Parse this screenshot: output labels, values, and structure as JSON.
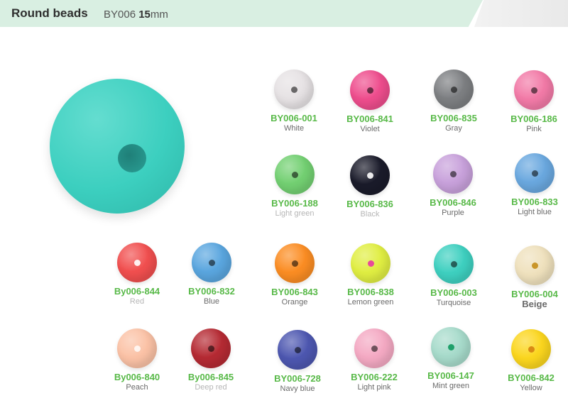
{
  "header": {
    "title": "Round beads",
    "code_prefix": "BY006",
    "size_value": "15",
    "size_unit": "mm"
  },
  "colors": {
    "header_band": "#d9efe2",
    "hero_bead": "#3ccfbf",
    "code_text": "#58b948"
  },
  "beads": [
    {
      "code": "BY006-001",
      "name": "White",
      "color": "#e6e2e4"
    },
    {
      "code": "BY006-841",
      "name": "Violet",
      "color": "#ee4d8d"
    },
    {
      "code": "BY006-835",
      "name": "Gray",
      "color": "#7d7f82"
    },
    {
      "code": "BY006-186",
      "name": "Pink",
      "color": "#f27aa7"
    },
    {
      "code": "BY006-188",
      "name": "Light green",
      "color": "#73d072"
    },
    {
      "code": "BY006-836",
      "name": "Black",
      "color": "#1a1b2a"
    },
    {
      "code": "BY006-846",
      "name": "Purple",
      "color": "#c8a1db"
    },
    {
      "code": "BY006-833",
      "name": "Light blue",
      "color": "#6aa8df"
    },
    {
      "code": "By006-844",
      "name": "Red",
      "color": "#f14f4f"
    },
    {
      "code": "BY006-832",
      "name": "Blue",
      "color": "#5aa6df"
    },
    {
      "code": "BY006-843",
      "name": "Orange",
      "color": "#fb8d23"
    },
    {
      "code": "BY006-838",
      "name": "Lemon green",
      "color": "#e0ee42"
    },
    {
      "code": "BY006-003",
      "name": "Turquoise",
      "color": "#3ed0c0"
    },
    {
      "code": "BY006-004",
      "name": "Beige",
      "color": "#efe1bd"
    },
    {
      "code": "By006-840",
      "name": "Peach",
      "color": "#fbc2a6"
    },
    {
      "code": "By006-845",
      "name": "Deep red",
      "color": "#b52a33"
    },
    {
      "code": "BY006-728",
      "name": "Navy blue",
      "color": "#4d57b0"
    },
    {
      "code": "BY006-222",
      "name": "Light pink",
      "color": "#f4a9c3"
    },
    {
      "code": "BY006-147",
      "name": "Mint green",
      "color": "#a7dbcb"
    },
    {
      "code": "BY006-842",
      "name": "Yellow",
      "color": "#fbd61e"
    }
  ]
}
